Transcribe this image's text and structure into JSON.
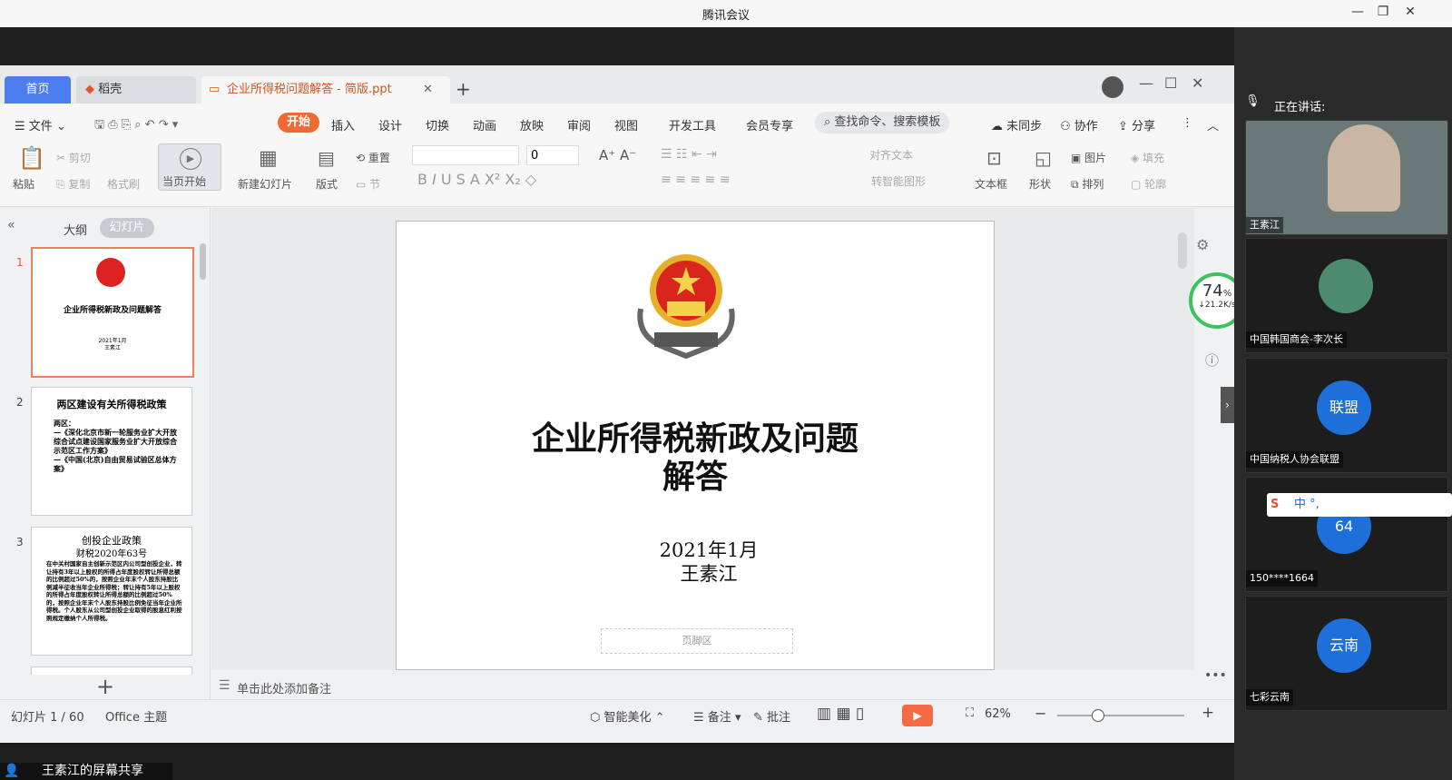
{
  "app_title": "腾讯会议",
  "wps": {
    "tabs": {
      "home": "首页",
      "daoke": "稻壳",
      "doc": "企业所得税问题解答 - 简版.ppt"
    },
    "menu": {
      "file": "文件",
      "start": "开始",
      "items": [
        "插入",
        "设计",
        "切换",
        "动画",
        "放映",
        "审阅",
        "视图",
        "开发工具",
        "会员专享"
      ],
      "search": "查找命令、搜索模板",
      "unsynced": "未同步",
      "collab": "协作",
      "share": "分享"
    },
    "ribbon": {
      "paste": "粘贴",
      "cut": "剪切",
      "copy": "复制",
      "format_painter": "格式刷",
      "play_current": "当页开始",
      "new_slide": "新建幻灯片",
      "layout": "版式",
      "reset": "重置",
      "section": "节",
      "font_size": "0",
      "align_text": "对齐文本",
      "smart_shape": "转智能图形",
      "textbox": "文本框",
      "shape": "形状",
      "picture": "图片",
      "arrange": "排列",
      "fill": "填充",
      "outline": "轮廓"
    },
    "left_panel": {
      "tab_outline": "大纲",
      "tab_slides": "幻灯片",
      "slides": [
        {
          "num": "1",
          "title": "企业所得税新政及问题解答",
          "date": "2021年1月",
          "author": "王素江"
        },
        {
          "num": "2",
          "title": "两区建设有关所得税政策",
          "body": "两区：\n—《深化北京市新一轮服务业扩大开放综合试点建设国家服务业扩大开放综合示范区工作方案》\n—《中国(北京)自由贸易试验区总体方案》"
        },
        {
          "num": "3",
          "title": "创投企业政策",
          "subtitle": "财税2020年63号",
          "body": "在中关村国家自主创新示范区内公司型创投企业，转让持有3年以上股权的所得占年度股权转让所得总额的比例超过50%的，按照企业年末个人股东持股比例减半征收当年企业所得税；转让持有5年以上股权的所得占年度股权转让所得总额的比例超过50%的，按照企业年末个人股东持股比例免征当年企业所得税。个人股东从公司型创投企业取得的股息红利按照规定缴纳个人所得税。"
        }
      ]
    },
    "slide": {
      "title_line1": "企业所得税新政及问题",
      "title_line2": "解答",
      "date": "2021年1月",
      "author": "王素江",
      "footer": "页脚区"
    },
    "notes_placeholder": "单击此处添加备注",
    "status": {
      "slide_count": "幻灯片 1 / 60",
      "theme": "Office 主题",
      "beautify": "智能美化",
      "notes": "备注",
      "comments": "批注",
      "zoom": "62%"
    },
    "network": {
      "percent": "74",
      "unit": "%",
      "speed": "↓21.2K/s"
    }
  },
  "meeting": {
    "speaking_label": "正在讲话:",
    "participants": [
      {
        "name": "王素江",
        "type": "video"
      },
      {
        "name": "中国韩国商会-李次长",
        "type": "photo"
      },
      {
        "name": "中国纳税人协会联盟",
        "type": "avatar",
        "avatar_text": "联盟"
      },
      {
        "name": "150****1664",
        "type": "avatar",
        "avatar_text": "64"
      },
      {
        "name": "七彩云南",
        "type": "avatar",
        "avatar_text": "云南"
      }
    ],
    "share_label": "王素江的屏幕共享",
    "ime_bar": "中 °,"
  },
  "colors": {
    "accent": "#f06a35",
    "home_tab": "#4c7ef0",
    "avatar_blue": "#1e6fd9",
    "network_green": "#3cc35a"
  }
}
